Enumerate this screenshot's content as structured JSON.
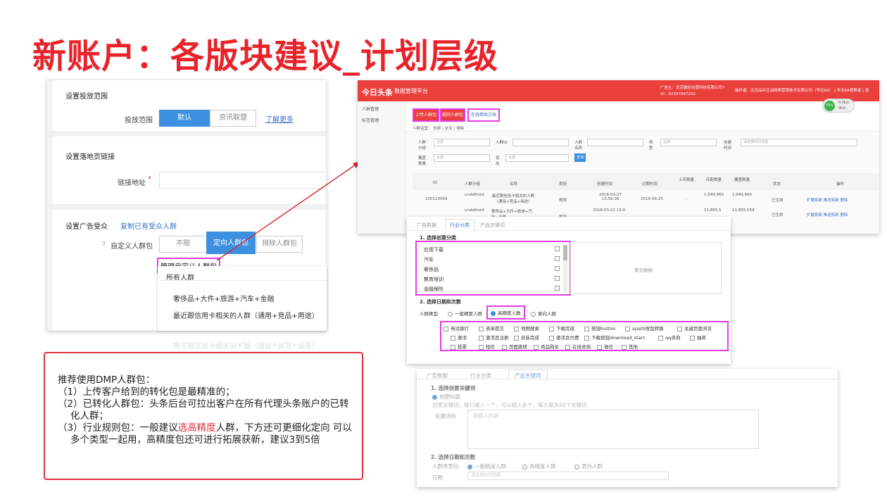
{
  "title": "新账户：各版块建议_计划层级",
  "left": {
    "sec1_title": "设置投放范围",
    "range_label": "投放范围",
    "range_opts": [
      "默认",
      "资讯联盟"
    ],
    "learn_more": "了解更多",
    "sec2_title": "设置落地页链接",
    "link_label": "链接地址",
    "required_mark": "*",
    "sec3_title": "设置广告受众",
    "copy_link": "复制已有受众人群",
    "custom_label": "自定义人群包",
    "aud_opts": [
      "不限",
      "定向人群包",
      "排除人群包"
    ],
    "manage_link": "管理自定义人群包",
    "dropdown": [
      "所有人群",
      "奢侈品+大件+旅游+汽车+金融",
      "最近跟信用卡相关的人群（通用+竞品+用途）"
    ],
    "ghost": "最近跟信用卡相关的人群（通用+竞品+用途）"
  },
  "top": {
    "logo": "今日头条",
    "platform": "数据管理平台",
    "adv": "广告主：北京融创炎值科技有限公司?",
    "adv_id": "ID：92397097250",
    "operator": "操作者：北京品众互动网络营销技术有限公司（华北KA） | 华北KA观察者 | 退",
    "side": [
      "人群管理",
      "标签管理"
    ],
    "buttons": [
      "上传人群包",
      "规则人群包",
      "在线帮助文档"
    ],
    "tabs": "人群运营：  全部  |  交叉  |  排除",
    "f_labels": [
      "人群分组",
      "人群ID",
      "人群名称",
      "类型",
      "创建时间",
      "覆盖数量",
      "状态"
    ],
    "f_vals": [
      "全部",
      "全部",
      "全部",
      "全部",
      "请选择时间范围"
    ],
    "query": "查询",
    "cols": [
      "ID",
      "人群分组",
      "名称",
      "类别",
      "创建时间",
      "过期时间",
      "上传数量",
      "匹配数量",
      "覆盖数量",
      "状态",
      "操作"
    ],
    "row1": [
      "100110069",
      "undefined",
      "最近跟信用卡相关的人群（通用+竞品+用途）",
      "规则",
      "2018-03-27 13:56:36",
      "2018-06-25",
      "-",
      "1,649,460",
      "1,649,460",
      "已生效",
      "扩展拓新 推送拓新 删除"
    ],
    "row2": [
      "",
      "undefined",
      "奢侈品+大件+旅游+汽车+金融",
      "规则",
      "2018-03-22 13:0",
      "",
      "",
      "11,855,5",
      "11,855,559",
      "已生效",
      "扩展拓新 推送拓新 删除"
    ],
    "badge": "70%",
    "speeds": [
      "0.0k/s",
      "0k/s"
    ]
  },
  "mid": {
    "tabs": [
      "广告数据",
      "行业分类",
      "产品关键词"
    ],
    "s1": "1. 选择创意分类",
    "cats": [
      "应用下载",
      "汽车",
      "奢侈品",
      "教育培训",
      "金融保险"
    ],
    "nodata": "暂无数据",
    "s2": "2. 选择日期和次数",
    "type_label": "人群类型",
    "types": [
      "一般精度人群",
      "高精度人群",
      "意向人群"
    ],
    "checks": [
      "电话拨打",
      "表单提交",
      "地图搜索",
      "下载完成",
      "按钮button",
      "xpath按型转换",
      "关键页面浏览",
      "激活",
      "激活且注册",
      "安装完成",
      "激活且付费",
      "下载按钮download_start",
      "qq咨询",
      "抽奖",
      "投票",
      "短信",
      "页面跳转",
      "商品购买",
      "在线咨询",
      "微信",
      "其他"
    ]
  },
  "bot": {
    "tabs": [
      "广告数据",
      "行业分类",
      "产品关键词"
    ],
    "s1": "1. 选择创意关键词",
    "radio": "创意标题",
    "hint": "创意关键词，每行输入一个，可以输入多个，每次最多50个关键词",
    "kw_label": "关键词列",
    "kw_ph": "请输入内容",
    "s2": "2. 选择日期和次数",
    "type_label": "人群类型包",
    "types": [
      "一般精度人群",
      "高精度人群",
      "意向人群"
    ],
    "date_label": "日期",
    "date_ph": "请选择时间范围"
  },
  "note": {
    "l1": "推荐使用DMP人群包：",
    "l2": "（1）上传客户给到的转化包是最精准的；",
    "l3": "（2）已转化人群包：头条后台可拉出客户在所有代理头条账户的已转化人群；",
    "l4a": "（3）行业规则包：一般建议",
    "l4b": "选高精度",
    "l4c": "人群，下方还可更细化定向 可以多个类型一起用，高精度包还可进行拓展获新，建议3到5倍"
  }
}
